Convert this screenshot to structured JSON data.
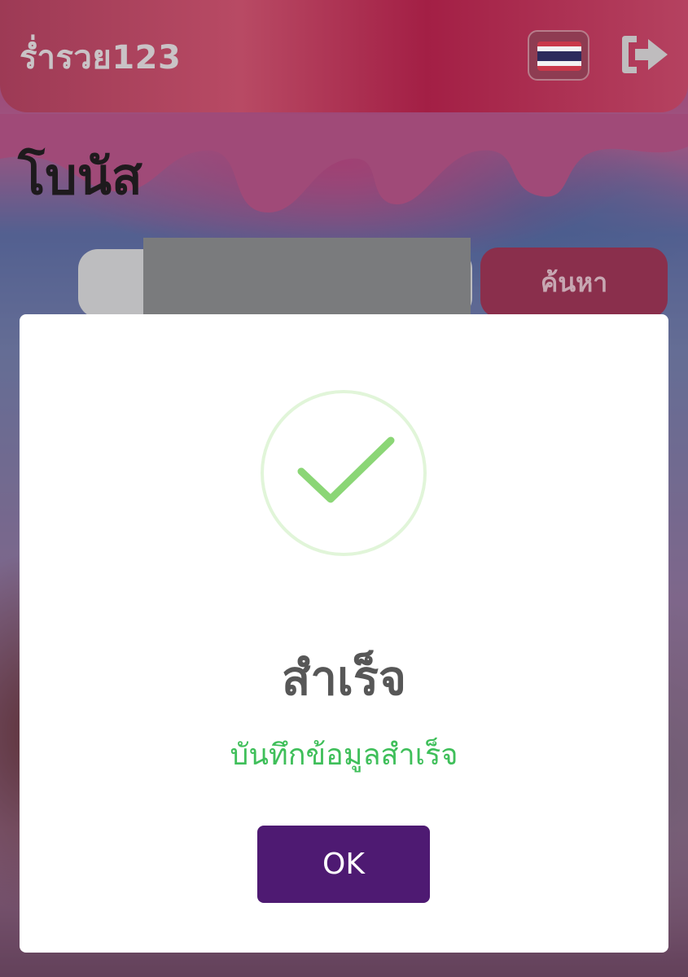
{
  "header": {
    "logo_text": "ร่ำรวย123",
    "language_flag": "thailand-flag",
    "logout_icon": "logout-icon"
  },
  "page": {
    "title": "โบนัส"
  },
  "search": {
    "value": "",
    "placeholder": "",
    "button_label": "ค้นหา"
  },
  "modal": {
    "icon": "success-check-icon",
    "title": "สำเร็จ",
    "message": "บันทึกข้อมูลสำเร็จ",
    "ok_label": "OK"
  },
  "colors": {
    "accent_purple": "#4e1a72",
    "success_green": "#3fbf5a",
    "check_green": "#8bd676",
    "header_red": "#a31f45"
  }
}
